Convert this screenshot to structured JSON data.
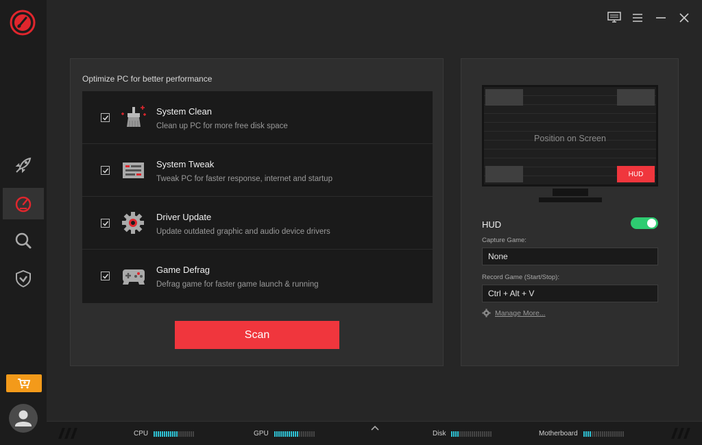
{
  "main": {
    "panel_title": "Optimize PC for better performance",
    "items": [
      {
        "title": "System Clean",
        "desc": "Clean up PC for more free disk space",
        "checked": true,
        "icon": "broom-icon"
      },
      {
        "title": "System Tweak",
        "desc": "Tweak PC for faster response, internet and startup",
        "checked": true,
        "icon": "tweak-panel-icon"
      },
      {
        "title": "Driver Update",
        "desc": "Update outdated graphic and audio device drivers",
        "checked": true,
        "icon": "gear-icon"
      },
      {
        "title": "Game Defrag",
        "desc": "Defrag game for faster game launch & running",
        "checked": true,
        "icon": "gamepad-icon"
      }
    ],
    "scan_label": "Scan"
  },
  "hud": {
    "preview_text": "Position on Screen",
    "preview_badge": "HUD",
    "label": "HUD",
    "enabled": true,
    "capture_label": "Capture Game:",
    "capture_value": "None",
    "record_label": "Record Game (Start/Stop):",
    "record_value": "Ctrl + Alt + V",
    "manage_label": "Manage More..."
  },
  "status": {
    "cpu": {
      "label": "CPU",
      "level": 0.6
    },
    "gpu": {
      "label": "GPU",
      "level": 0.6
    },
    "disk": {
      "label": "Disk",
      "level": 0.2
    },
    "motherboard": {
      "label": "Motherboard",
      "level": 0.2
    }
  },
  "colors": {
    "accent": "#f0363d",
    "toggle_on": "#2ecc71",
    "meter": "#2fc3d6",
    "store": "#f39a1a"
  }
}
